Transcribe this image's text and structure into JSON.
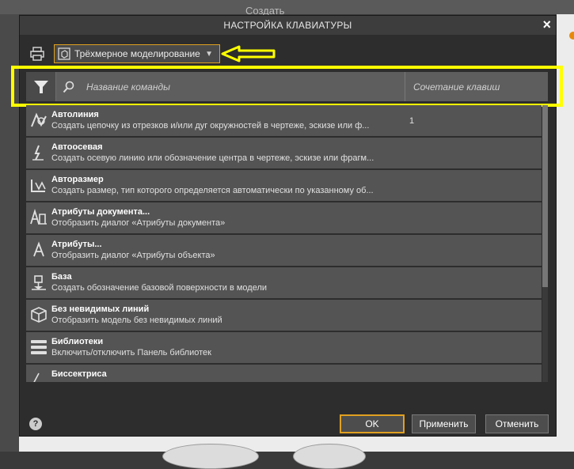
{
  "background": {
    "title": "Создать"
  },
  "dialog": {
    "title": "НАСТРОЙКА КЛАВИАТУРЫ",
    "close_label": "×",
    "profile_select": "Трёхмерное моделирование"
  },
  "filter": {
    "command_placeholder": "Название команды",
    "shortcut_placeholder": "Сочетание клавиш"
  },
  "commands": [
    {
      "icon": "autoline-icon",
      "title": "Автолиния",
      "desc": "Создать цепочку из отрезков и/или дуг окружностей в чертеже, эскизе или ф...",
      "shortcut": "1"
    },
    {
      "icon": "axis-icon",
      "title": "Автоосевая",
      "desc": "Создать осевую линию или обозначение центра в чертеже, эскизе или фрагм...",
      "shortcut": ""
    },
    {
      "icon": "autosize-icon",
      "title": "Авторазмер",
      "desc": "Создать размер, тип которого определяется автоматически по указанному об...",
      "shortcut": ""
    },
    {
      "icon": "doc-attributes-icon",
      "title": "Атрибуты документа...",
      "desc": "Отобразить диалог «Атрибуты документа»",
      "shortcut": ""
    },
    {
      "icon": "attributes-icon",
      "title": "Атрибуты...",
      "desc": "Отобразить диалог «Атрибуты объекта»",
      "shortcut": ""
    },
    {
      "icon": "base-icon",
      "title": "База",
      "desc": "Создать обозначение базовой поверхности в модели",
      "shortcut": ""
    },
    {
      "icon": "no-hidden-lines-icon",
      "title": "Без невидимых линий",
      "desc": "Отобразить модель без невидимых линий",
      "shortcut": ""
    },
    {
      "icon": "libraries-icon",
      "title": "Библиотеки",
      "desc": "Включить/отключить Панель библиотек",
      "shortcut": ""
    },
    {
      "icon": "bisector-icon",
      "title": "Биссектриса",
      "desc": "",
      "shortcut": ""
    }
  ],
  "footer": {
    "help": "?",
    "ok": "OK",
    "apply": "Применить",
    "cancel": "Отменить"
  },
  "colors": {
    "accent": "#e0a020",
    "annotation": "#ffff00"
  }
}
